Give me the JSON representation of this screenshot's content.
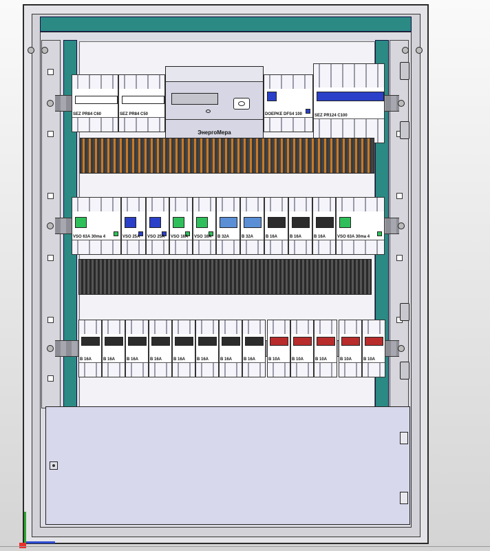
{
  "row1": {
    "breakers": [
      {
        "label": "SEZ PR84 C60",
        "toggle": "#ffffff"
      },
      {
        "label": "SEZ PR84 C50",
        "toggle": "#ffffff"
      },
      {
        "label": "DOEPKE DFS4 100",
        "toggle": "#2a40c8"
      },
      {
        "label": "SEZ PR124 C100",
        "toggle": "#2a40c8"
      }
    ],
    "meter": {
      "brand": "ЭнергоМера"
    }
  },
  "row2": {
    "breakers": [
      {
        "label": "VSO 63A 30ma 4",
        "toggle": "#2fbf5a"
      },
      {
        "label": "VSO 25A",
        "toggle": "#2a40c8"
      },
      {
        "label": "VSO 25A",
        "toggle": "#2a40c8"
      },
      {
        "label": "VSO 16A",
        "toggle": "#2fbf5a"
      },
      {
        "label": "VSO 16A",
        "toggle": "#2fbf5a"
      },
      {
        "label": "B 32A",
        "toggle": "#5a8fd6"
      },
      {
        "label": "B 32A",
        "toggle": "#5a8fd6"
      },
      {
        "label": "B 16A",
        "toggle": "#2c2c2c"
      },
      {
        "label": "B 16A",
        "toggle": "#2c2c2c"
      },
      {
        "label": "B 16A",
        "toggle": "#2c2c2c"
      },
      {
        "label": "VSO 63A 30ma 4",
        "toggle": "#2fbf5a"
      }
    ]
  },
  "row3": {
    "breakers": [
      {
        "label": "B 16A",
        "toggle": "#2c2c2c"
      },
      {
        "label": "B 16A",
        "toggle": "#2c2c2c"
      },
      {
        "label": "B 16A",
        "toggle": "#2c2c2c"
      },
      {
        "label": "B 16A",
        "toggle": "#2c2c2c"
      },
      {
        "label": "B 16A",
        "toggle": "#2c2c2c"
      },
      {
        "label": "B 16A",
        "toggle": "#2c2c2c"
      },
      {
        "label": "B 16A",
        "toggle": "#2c2c2c"
      },
      {
        "label": "B 16A",
        "toggle": "#2c2c2c"
      },
      {
        "label": "B 10A",
        "toggle": "#b82c2c"
      },
      {
        "label": "B 10A",
        "toggle": "#b82c2c"
      },
      {
        "label": "B 10A",
        "toggle": "#b82c2c"
      },
      {
        "label": "B 10A",
        "toggle": "#b82c2c"
      },
      {
        "label": "B 10A",
        "toggle": "#b82c2c"
      }
    ]
  }
}
